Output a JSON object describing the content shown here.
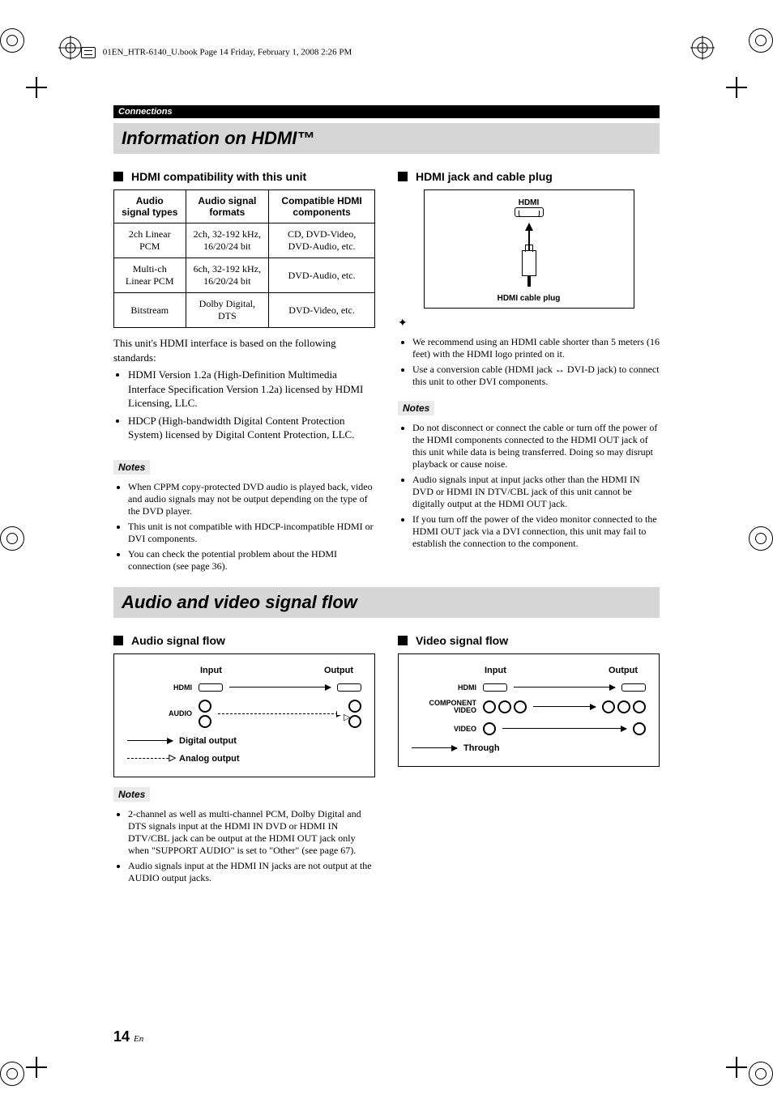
{
  "filestamp": "01EN_HTR-6140_U.book  Page 14  Friday, February 1, 2008  2:26 PM",
  "section_bar": "Connections",
  "heading1": "Information on HDMI™",
  "heading2": "Audio and video signal flow",
  "left": {
    "sub1": "HDMI compatibility with this unit",
    "table": {
      "h1": "Audio signal types",
      "h2": "Audio signal formats",
      "h3": "Compatible HDMI components",
      "rows": [
        {
          "c1": "2ch Linear PCM",
          "c2": "2ch, 32-192 kHz, 16/20/24 bit",
          "c3": "CD, DVD-Video, DVD-Audio, etc."
        },
        {
          "c1": "Multi-ch Linear PCM",
          "c2": "6ch, 32-192 kHz, 16/20/24 bit",
          "c3": "DVD-Audio, etc."
        },
        {
          "c1": "Bitstream",
          "c2": "Dolby Digital, DTS",
          "c3": "DVD-Video, etc."
        }
      ]
    },
    "standards_intro": "This unit's HDMI interface is based on the following standards:",
    "standards": [
      "HDMI Version 1.2a (High-Definition Multimedia Interface Specification Version 1.2a) licensed by HDMI Licensing, LLC.",
      "HDCP (High-bandwidth Digital Content Protection System) licensed by Digital Content Protection, LLC."
    ],
    "notes_label": "Notes",
    "notes": [
      "When CPPM copy-protected DVD audio is played back, video and audio signals may not be output depending on the type of the DVD player.",
      "This unit is not compatible with HDCP-incompatible HDMI or DVI components.",
      "You can check the potential problem about the HDMI connection (see page 36)."
    ]
  },
  "right": {
    "sub1": "HDMI jack and cable plug",
    "hdmi_label_top": "HDMI",
    "hdmi_cable_label": "HDMI cable plug",
    "tips": [
      "We recommend using an HDMI cable shorter than 5 meters (16 feet) with the HDMI logo printed on it.",
      "Use a conversion cable (HDMI jack ↔ DVI-D jack) to connect this unit to other DVI components."
    ],
    "notes_label": "Notes",
    "notes": [
      "Do not disconnect or connect the cable or turn off the power of the HDMI components connected to the HDMI OUT jack of this unit while data is being transferred. Doing so may disrupt playback or cause noise.",
      "Audio signals input at input jacks other than the HDMI IN DVD or HDMI IN DTV/CBL jack of this unit cannot be digitally output at the HDMI OUT jack.",
      "If you turn off the power of the video monitor connected to the HDMI OUT jack via a DVI connection, this unit may fail to establish the connection to the component."
    ]
  },
  "flow": {
    "audio_sub": "Audio signal flow",
    "video_sub": "Video signal flow",
    "input": "Input",
    "output": "Output",
    "hdmi": "HDMI",
    "audio": "AUDIO",
    "component": "COMPONENT VIDEO",
    "video": "VIDEO",
    "legend_digital": "Digital output",
    "legend_analog": "Analog output",
    "legend_through": "Through",
    "notes_label": "Notes",
    "notes": [
      "2-channel as well as multi-channel PCM, Dolby Digital and DTS signals input at the HDMI IN DVD or HDMI IN DTV/CBL jack can be output at the HDMI OUT jack only when \"SUPPORT AUDIO\" is set to \"Other\" (see page 67).",
      "Audio signals input at the HDMI IN jacks are not output at the AUDIO output jacks."
    ]
  },
  "page_number": "14",
  "page_suffix": "En"
}
